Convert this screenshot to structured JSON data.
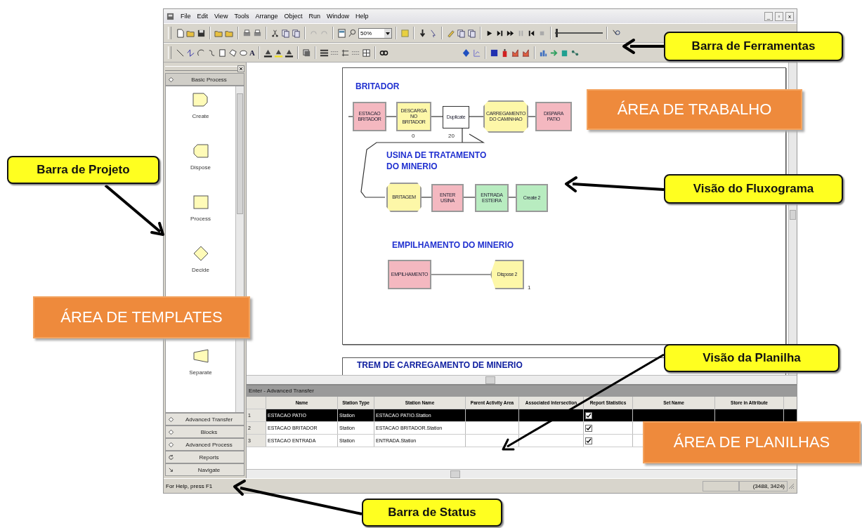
{
  "menu": [
    "File",
    "Edit",
    "View",
    "Tools",
    "Arrange",
    "Object",
    "Run",
    "Window",
    "Help"
  ],
  "window_controls": [
    "_",
    "▫",
    "x"
  ],
  "zoom_field": {
    "value": "50%"
  },
  "speed_slider": {
    "level": 0.02
  },
  "text_tool": "A",
  "templates": {
    "header": "Basic Process",
    "items": [
      {
        "label": "Create",
        "kind": "create"
      },
      {
        "label": "Dispose",
        "kind": "dispose"
      },
      {
        "label": "Process",
        "kind": "process"
      },
      {
        "label": "Decide",
        "kind": "decide"
      },
      {
        "label": "Separate",
        "kind": "separate"
      }
    ],
    "panels": [
      {
        "label": "Advanced Transfer",
        "kind": "panel"
      },
      {
        "label": "Blocks",
        "kind": "panel"
      },
      {
        "label": "Advanced Process",
        "kind": "panel"
      },
      {
        "label": "Reports",
        "kind": "reports"
      },
      {
        "label": "Navigate",
        "kind": "navigate"
      }
    ]
  },
  "flowchart": {
    "sections": [
      "BRITADOR",
      "USINA DE TRATAMENTO DO MINERIO",
      "EMPILHAMENTO DO MINERIO"
    ],
    "nodes": [
      {
        "label": "ESTACAO BRITADOR",
        "kind": "station",
        "color": "#f4b8c0"
      },
      {
        "label": "DESCARGA NO BRITADOR",
        "kind": "process",
        "color": "#fdf7a8"
      },
      {
        "label": "Duplicate",
        "kind": "separate",
        "color": "#ffffff"
      },
      {
        "label": "CARREGAMENTO DO CAMINHAO",
        "kind": "octagon",
        "color": "#fdf7a8"
      },
      {
        "label": "DISPARA PATIO",
        "kind": "station",
        "color": "#f4b8c0"
      },
      {
        "label": "BRITAGEM",
        "kind": "octagon",
        "color": "#fdf7a8"
      },
      {
        "label": "ENTER USINA",
        "kind": "station",
        "color": "#f4b8c0"
      },
      {
        "label": "ENTRADA ESTEIRA",
        "kind": "route",
        "color": "#b8ecc0"
      },
      {
        "label": "Create 2",
        "kind": "route",
        "color": "#b8ecc0"
      },
      {
        "label": "EMPILHAMENTO",
        "kind": "station",
        "color": "#f4b8c0"
      },
      {
        "label": "Dispose 2",
        "kind": "dispose",
        "color": "#fdf7a8"
      }
    ],
    "counters": [
      "0",
      "20",
      "1"
    ],
    "next_section": "TREM DE CARREGAMENTO DE MINERIO"
  },
  "spreadsheet": {
    "title": "Enter - Advanced Transfer",
    "columns": [
      "Name",
      "Station Type",
      "Station Name",
      "Parent Activity Area",
      "Associated Intersection",
      "Report Statistics",
      "Set Name",
      "Store in Attribute"
    ],
    "rows": [
      {
        "number": "1",
        "name": "ESTACAO PATIO",
        "station_type": "Station",
        "station_name": "ESTACAO PATIO.Station",
        "report_statistics": true,
        "selected": true
      },
      {
        "number": "2",
        "name": "ESTACAO BRITADOR",
        "station_type": "Station",
        "station_name": "ESTACAO BRITADOR.Station",
        "report_statistics": true,
        "selected": false
      },
      {
        "number": "3",
        "name": "ESTACAO ENTRADA",
        "station_type": "Station",
        "station_name": "ENTRADA.Station",
        "report_statistics": true,
        "selected": false
      }
    ]
  },
  "status_bar": {
    "help": "For Help, press F1",
    "coordinates": "(3488, 3424)"
  },
  "annotations": [
    {
      "text": "Barra de Ferramentas",
      "kind": "callout"
    },
    {
      "text": "ÁREA DE TRABALHO",
      "kind": "area"
    },
    {
      "text": "Barra de Projeto",
      "kind": "callout"
    },
    {
      "text": "Visão do Fluxograma",
      "kind": "callout"
    },
    {
      "text": "ÁREA DE TEMPLATES",
      "kind": "area"
    },
    {
      "text": "Visão da Planilha",
      "kind": "callout"
    },
    {
      "text": "ÁREA DE PLANILHAS",
      "kind": "area"
    },
    {
      "text": "Barra de Status",
      "kind": "callout"
    }
  ]
}
